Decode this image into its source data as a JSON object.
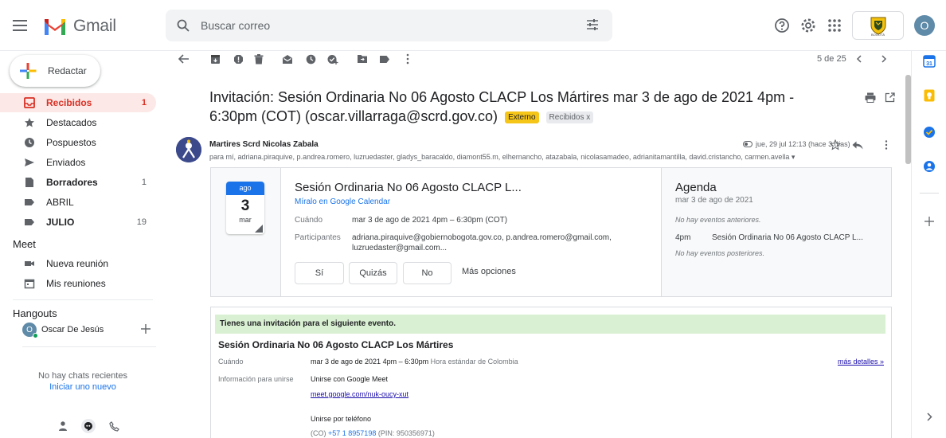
{
  "app": {
    "name": "Gmail"
  },
  "search": {
    "placeholder": "Buscar correo"
  },
  "header": {
    "avatar_letter": "O",
    "org_label": "BOGOTÁ"
  },
  "compose": {
    "label": "Redactar"
  },
  "nav": {
    "items": [
      {
        "label": "Recibidos",
        "count": "1",
        "icon": "inbox-icon"
      },
      {
        "label": "Destacados",
        "count": "",
        "icon": "star-icon"
      },
      {
        "label": "Pospuestos",
        "count": "",
        "icon": "clock-icon"
      },
      {
        "label": "Enviados",
        "count": "",
        "icon": "send-icon"
      },
      {
        "label": "Borradores",
        "count": "1",
        "icon": "draft-icon"
      },
      {
        "label": "ABRIL",
        "count": "",
        "icon": "label-icon"
      },
      {
        "label": "JULIO",
        "count": "19",
        "icon": "label-icon"
      }
    ],
    "meet_title": "Meet",
    "meet_items": [
      {
        "label": "Nueva reunión",
        "icon": "video-icon"
      },
      {
        "label": "Mis reuniones",
        "icon": "calendar-icon"
      }
    ],
    "hangouts_title": "Hangouts",
    "hangouts_user": "Oscar De Jesús",
    "hangouts_user_letter": "O",
    "no_chats": "No hay chats recientes",
    "start_new": "Iniciar uno nuevo"
  },
  "pager": {
    "text": "5 de 25"
  },
  "email": {
    "subject": "Invitación: Sesión Ordinaria No 06 Agosto CLACP Los Mártires mar 3 de ago de 2021 4pm - 6:30pm (COT) (oscar.villarraga@scrd.gov.co)",
    "labels": {
      "external": "Externo",
      "inbox": "Recibidos x"
    },
    "sender": "Martires Scrd Nicolas Zabala",
    "recipients": "para mí, adriana.piraquive, p.andrea.romero, luzruedaster, gladys_baracaldo, diamont55.m, elhernancho, atazabala, nicolasamadeo, adrianitamantilla, david.cristancho, carmen.avella ▾",
    "date": "jue, 29 jul 12:13 (hace 3 días)"
  },
  "calendar_card": {
    "month": "ago",
    "day": "3",
    "weekday": "mar",
    "title": "Sesión Ordinaria No 06 Agosto CLACP L...",
    "view_link": "Míralo en Google Calendar",
    "when_label": "Cuándo",
    "when_value": "mar 3 de ago de 2021 4pm – 6:30pm (COT)",
    "participants_label": "Participantes",
    "participants_value": "adriana.piraquive@gobiernobogota.gov.co, p.andrea.romero@gmail.com,",
    "participants_value2": "luzruedaster@gmail.com...",
    "rsvp": {
      "yes": "Sí",
      "maybe": "Quizás",
      "no": "No",
      "more": "Más opciones"
    },
    "agenda": {
      "title": "Agenda",
      "date": "mar 3 de ago de 2021",
      "no_prev": "No hay eventos anteriores.",
      "event_time": "4pm",
      "event_title": "Sesión Ordinaria No 06 Agosto CLACP L...",
      "no_next": "No hay eventos posteriores."
    }
  },
  "invite": {
    "banner": "Tienes una invitación para el siguiente evento.",
    "title": "Sesión Ordinaria No 06 Agosto CLACP Los Mártires",
    "when_label": "Cuándo",
    "when_value": "mar 3 de ago de 2021 4pm – 6:30pm",
    "when_tz": "Hora estándar de Colombia",
    "more_details": "más detalles »",
    "join_label": "Información para unirse",
    "join_meet": "Unirse con Google Meet",
    "meet_link": "meet.google.com/nuk-oucy-xut",
    "join_phone": "Unirse por teléfono",
    "phone_prefix": "(CO)",
    "phone_number": "+57 1 8957198",
    "phone_pin": "(PIN: 950356971)"
  },
  "colors": {
    "accent": "#1a73e8",
    "inbox_active": "#d93025",
    "external_label": "#f5c518"
  }
}
